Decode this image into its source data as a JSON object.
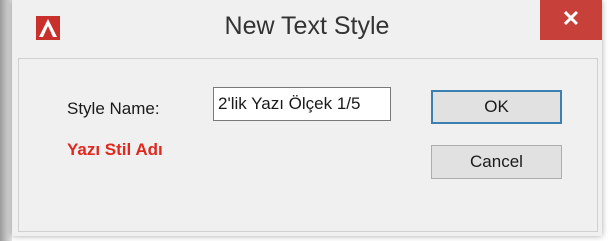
{
  "window": {
    "title": "New Text Style",
    "app_icon": "autocad-logo-icon",
    "close_label": "✕"
  },
  "form": {
    "style_name_label": "Style Name:",
    "style_name_value": "2'lik Yazı Ölçek 1/5",
    "annotation": "Yazı Stil Adı"
  },
  "buttons": {
    "ok_label": "OK",
    "cancel_label": "Cancel"
  },
  "colors": {
    "close_button": "#c7403a",
    "annotation": "#e0281e",
    "ok_border": "#3c7fb1",
    "app_icon": "#c9302c"
  }
}
